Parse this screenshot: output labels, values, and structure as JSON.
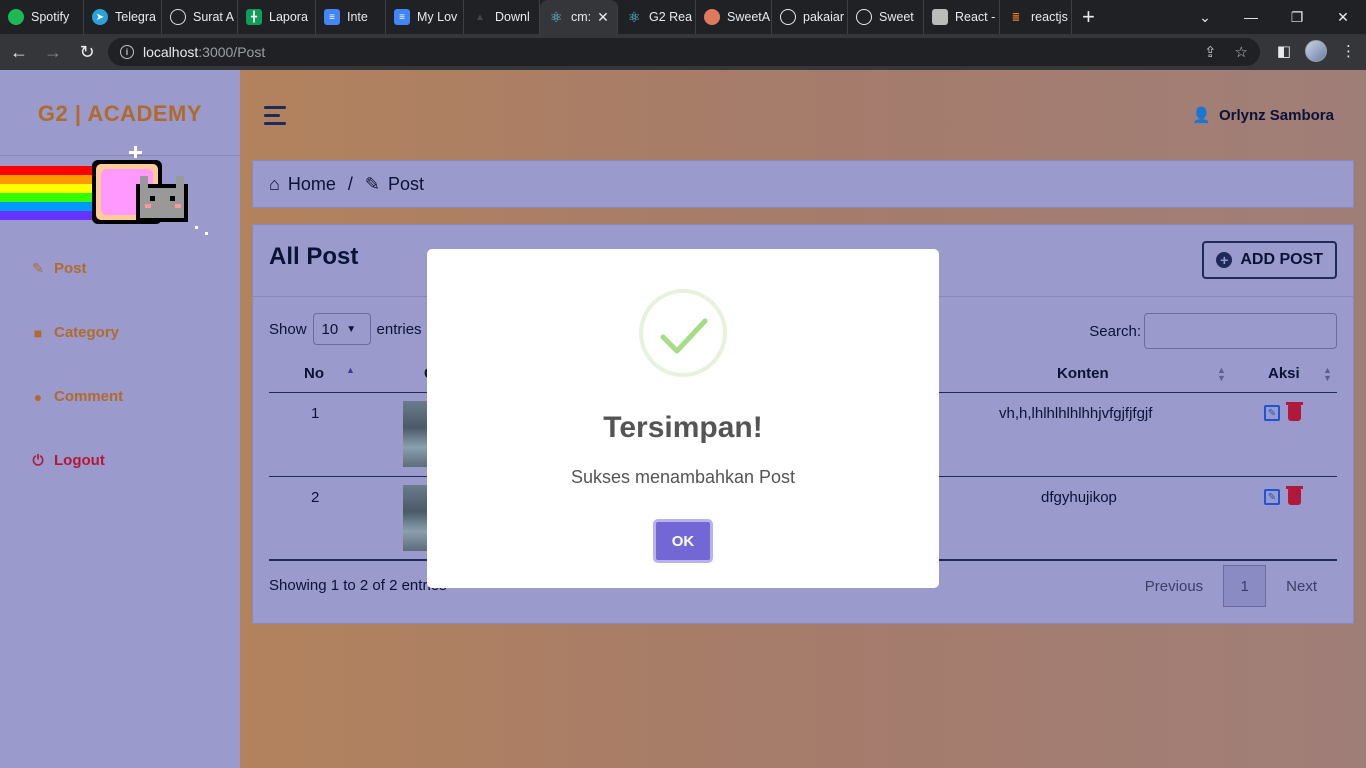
{
  "browser": {
    "tabs": [
      {
        "label": "Spotify",
        "icon": "spotify-icon",
        "color": "#1db954"
      },
      {
        "label": "Telegra",
        "icon": "telegram-icon",
        "color": "#2aa1da"
      },
      {
        "label": "Surat A",
        "icon": "globe-icon",
        "color": "#dddddd"
      },
      {
        "label": "Lapora",
        "icon": "sheets-icon",
        "color": "#0f9d58"
      },
      {
        "label": "Inte",
        "icon": "docs-icon",
        "color": "#4285f4"
      },
      {
        "label": "My Lov",
        "icon": "docs-icon",
        "color": "#4285f4"
      },
      {
        "label": "Downl",
        "icon": "site-icon",
        "color": "#444444"
      },
      {
        "label": "cm:",
        "icon": "react-icon",
        "color": "#61dafb",
        "active": true
      },
      {
        "label": "G2 Rea",
        "icon": "react-icon",
        "color": "#61dafb"
      },
      {
        "label": "SweetA",
        "icon": "sweetalert-icon",
        "color": "#e07a5f"
      },
      {
        "label": "pakaiar",
        "icon": "github-icon",
        "color": "#e8eaed"
      },
      {
        "label": "Sweet",
        "icon": "github-icon",
        "color": "#e8eaed"
      },
      {
        "label": "React -",
        "icon": "site-icon",
        "color": "#bbbbbb"
      },
      {
        "label": "reactjs",
        "icon": "stackoverflow-icon",
        "color": "#f48024"
      }
    ],
    "url_host": "localhost",
    "url_path": ":3000/Post"
  },
  "sidebar": {
    "brand": "G2 | ACADEMY",
    "items": [
      {
        "label": "Post",
        "icon": "pencil-icon"
      },
      {
        "label": "Category",
        "icon": "folder-icon"
      },
      {
        "label": "Comment",
        "icon": "comment-icon"
      },
      {
        "label": "Logout",
        "icon": "power-icon"
      }
    ]
  },
  "header": {
    "user_name": "Orlynz Sambora"
  },
  "breadcrumb": {
    "home": "Home",
    "separator": "/",
    "current": "Post"
  },
  "card": {
    "title": "All Post",
    "add_button": "ADD POST"
  },
  "datatable": {
    "show_label": "Show",
    "entries_value": "10",
    "entries_label": "entries",
    "search_label": "Search:",
    "columns": {
      "no": "No",
      "col2_fragment": "G",
      "konten": "Konten",
      "aksi": "Aksi"
    },
    "rows": [
      {
        "no": "1",
        "konten": "vh,h,lhlhlhlhlhhjvfgjfjfgjf"
      },
      {
        "no": "2",
        "konten": "dfgyhujikop"
      }
    ],
    "info": "Showing 1 to 2 of 2 entries",
    "pager": {
      "previous": "Previous",
      "current": "1",
      "next": "Next"
    }
  },
  "modal": {
    "title": "Tersimpan!",
    "text": "Sukses menambahkan Post",
    "ok_label": "OK",
    "icon": "success-check-icon"
  }
}
